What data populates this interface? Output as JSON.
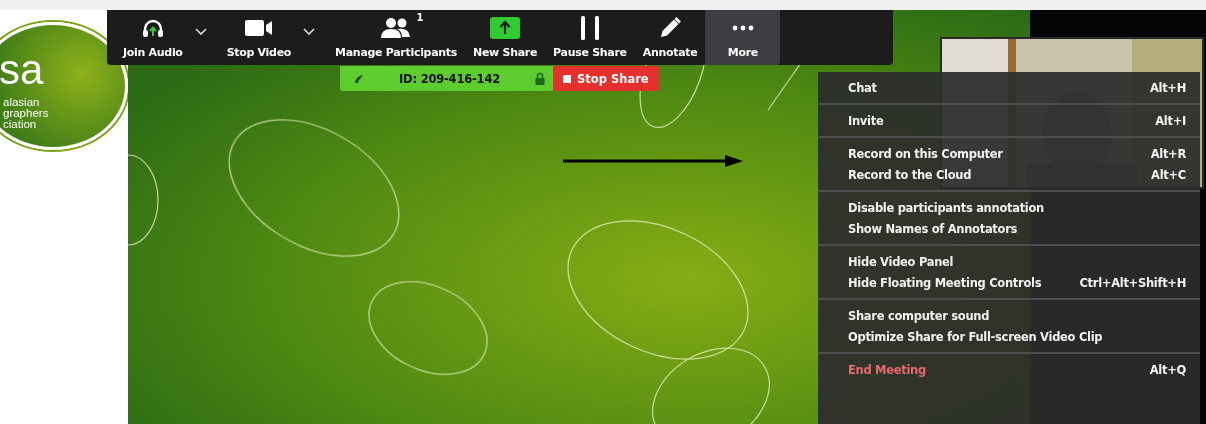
{
  "logo": {
    "mark": "sa",
    "lines": [
      "alasian",
      "graphers",
      "ciation"
    ]
  },
  "toolbar": {
    "buttons": [
      {
        "label": "Join Audio",
        "kind": "headphones",
        "caret": true,
        "selected": false
      },
      {
        "label": "Stop Video",
        "kind": "camera",
        "caret": true,
        "selected": false
      },
      {
        "label": "Manage Participants",
        "kind": "people",
        "badge": "1",
        "caret": false,
        "selected": false
      },
      {
        "label": "New Share",
        "kind": "share",
        "caret": false,
        "selected": false
      },
      {
        "label": "Pause Share",
        "kind": "pause",
        "caret": false,
        "selected": false
      },
      {
        "label": "Annotate",
        "kind": "pencil",
        "caret": false,
        "selected": false
      },
      {
        "label": "More",
        "kind": "dots",
        "caret": false,
        "selected": true
      }
    ]
  },
  "share_bar": {
    "meeting_id": "ID: 209-416-142",
    "stop_label": "Stop Share"
  },
  "more_menu": {
    "sections": [
      [
        {
          "label": "Chat",
          "shortcut": "Alt+H",
          "kind": "normal"
        }
      ],
      [
        {
          "label": "Invite",
          "shortcut": "Alt+I",
          "kind": "normal"
        }
      ],
      [
        {
          "label": "Record on this Computer",
          "shortcut": "Alt+R",
          "kind": "normal"
        },
        {
          "label": "Record to the Cloud",
          "shortcut": "Alt+C",
          "kind": "normal"
        }
      ],
      [
        {
          "label": "Disable participants annotation",
          "kind": "normal"
        },
        {
          "label": "Show Names of Annotators",
          "kind": "normal"
        }
      ],
      [
        {
          "label": "Hide Video Panel",
          "kind": "normal"
        },
        {
          "label": "Hide Floating Meeting Controls",
          "shortcut": "Ctrl+Alt+Shift+H",
          "kind": "normal"
        }
      ],
      [
        {
          "label": "Share computer sound",
          "kind": "normal"
        },
        {
          "label": "Optimize Share for Full-screen Video Clip",
          "kind": "normal"
        }
      ],
      [
        {
          "label": "End Meeting",
          "shortcut": "Alt+Q",
          "kind": "danger"
        }
      ]
    ]
  }
}
